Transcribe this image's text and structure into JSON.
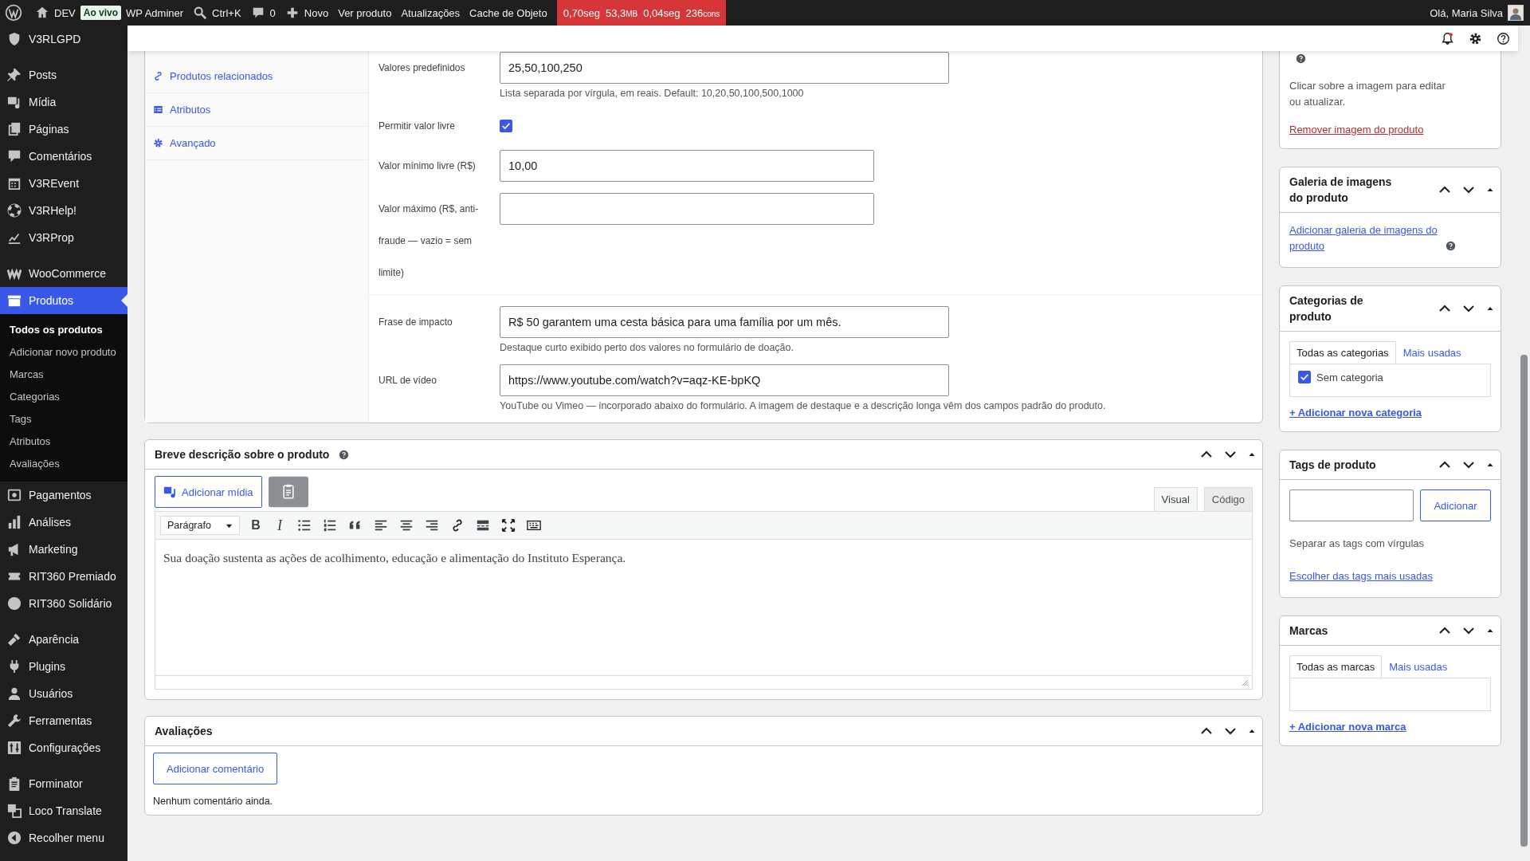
{
  "admin_bar": {
    "site": "DEV",
    "badge": "Ao vivo",
    "adminer": "WP Adminer",
    "search": "Ctrl+K",
    "comments": "0",
    "new": "Novo",
    "links": [
      "Ver produto",
      "Atualizações",
      "Cache de Objeto"
    ],
    "perf": [
      {
        "value": "0,70seg"
      },
      {
        "value": "53,3",
        "unit": "MB"
      },
      {
        "value": "0,04seg"
      },
      {
        "value": "236",
        "unit": "cons"
      }
    ],
    "greeting": "Olá, Maria Silva"
  },
  "sidebar": {
    "groups": [
      {
        "items": [
          {
            "label": "V3RLGPD",
            "selected": false
          }
        ]
      },
      {
        "items": [
          {
            "label": "Posts",
            "selected": false
          },
          {
            "label": "Mídia",
            "selected": false
          },
          {
            "label": "Páginas",
            "selected": false
          },
          {
            "label": "Comentários",
            "selected": false
          },
          {
            "label": "V3REvent",
            "selected": false
          },
          {
            "label": "V3RHelp!",
            "selected": false
          },
          {
            "label": "V3RProp",
            "selected": false
          }
        ]
      },
      {
        "items": [
          {
            "label": "WooCommerce",
            "selected": false
          },
          {
            "label": "Produtos",
            "selected": true,
            "expanded": true,
            "children": [
              {
                "label": "Todos os produtos",
                "selected": true
              },
              {
                "label": "Adicionar novo produto",
                "selected": false
              },
              {
                "label": "Marcas",
                "selected": false
              },
              {
                "label": "Categorias",
                "selected": false
              },
              {
                "label": "Tags",
                "selected": false
              },
              {
                "label": "Atributos",
                "selected": false
              },
              {
                "label": "Avaliações",
                "selected": false
              }
            ]
          },
          {
            "label": "Pagamentos",
            "selected": false
          },
          {
            "label": "Análises",
            "selected": false
          },
          {
            "label": "Marketing",
            "selected": false
          },
          {
            "label": "RIT360 Premiado",
            "selected": false
          },
          {
            "label": "RIT360 Solidário",
            "selected": false
          }
        ]
      },
      {
        "items": [
          {
            "label": "Aparência",
            "selected": false
          },
          {
            "label": "Plugins",
            "selected": false
          },
          {
            "label": "Usuários",
            "selected": false
          },
          {
            "label": "Ferramentas",
            "selected": false
          },
          {
            "label": "Configurações",
            "selected": false
          }
        ]
      },
      {
        "items": [
          {
            "label": "Forminator",
            "selected": false
          },
          {
            "label": "Loco Translate",
            "selected": false
          },
          {
            "label": "Recolher menu",
            "selected": false
          }
        ]
      }
    ]
  },
  "product_data": {
    "tabs": [
      {
        "label": "Produtos relacionados",
        "selected": false
      },
      {
        "label": "Atributos",
        "selected": false
      },
      {
        "label": "Avançado",
        "selected": false
      }
    ],
    "sections": [
      {
        "fields": [
          {
            "kind": "text",
            "label": "Valores predefinidos",
            "value": "25,50,100,250",
            "hint": "Lista separada por vírgula, em reais. Default: 10,20,50,100,500,1000"
          },
          {
            "kind": "checkbox",
            "label": "Permitir valor livre",
            "checked": true
          },
          {
            "kind": "number",
            "label": "Valor mínimo livre (R$)",
            "value": "10,00"
          },
          {
            "kind": "number",
            "label": "Valor máximo (R$, anti-fraude — vazio = sem limite)"
          }
        ]
      },
      {
        "fields": [
          {
            "kind": "text",
            "label": "Frase de impacto",
            "value": "R$ 50 garantem uma cesta básica para uma família por um mês.",
            "hint": "Destaque curto exibido perto dos valores no formulário de doação."
          },
          {
            "kind": "text",
            "label": "URL de vídeo",
            "value": "https://www.youtube.com/watch?v=aqz-KE-bpKQ",
            "hint": "YouTube ou Vimeo — incorporado abaixo do formulário. A imagem de destaque e a descrição longa vêm dos campos padrão do produto."
          }
        ]
      }
    ]
  },
  "short_description": {
    "title": "Breve descrição sobre o produto",
    "add_media": "Adicionar mídia",
    "tabs": [
      {
        "label": "Visual",
        "selected": true
      },
      {
        "label": "Código",
        "selected": false
      }
    ],
    "format": "Parágrafo",
    "glyphs": [
      "B",
      "I"
    ],
    "content": "Sua doação sustenta as ações de acolhimento, educação e alimentação do Instituto Esperança."
  },
  "reviews": {
    "title": "Avaliações",
    "button": "Adicionar comentário",
    "empty": "Nenhum comentário ainda."
  },
  "side_boxes": [
    {
      "kind": "image",
      "text": "Clicar sobre a imagem para editar ou atualizar.",
      "link": "Remover imagem do produto"
    },
    {
      "kind": "gallery",
      "title": "Galeria de imagens do produto",
      "link": "Adicionar galeria de imagens do produto"
    },
    {
      "kind": "terms",
      "title": "Categorias de produto",
      "tabs": [
        {
          "label": "Todas as categorias",
          "selected": true
        },
        {
          "label": "Mais usadas",
          "selected": false
        }
      ],
      "options": [
        {
          "label": "Sem categoria",
          "checked": true
        }
      ],
      "link": "+ Adicionar nova categoria"
    },
    {
      "kind": "tags",
      "title": "Tags de produto",
      "button": "Adicionar",
      "hint": "Separar as tags com vírgulas",
      "link": "Escolher das tags mais usadas"
    },
    {
      "kind": "terms",
      "title": "Marcas",
      "tabs": [
        {
          "label": "Todas as marcas",
          "selected": true
        },
        {
          "label": "Mais usadas",
          "selected": false
        }
      ],
      "link": "+ Adicionar nova marca"
    }
  ]
}
